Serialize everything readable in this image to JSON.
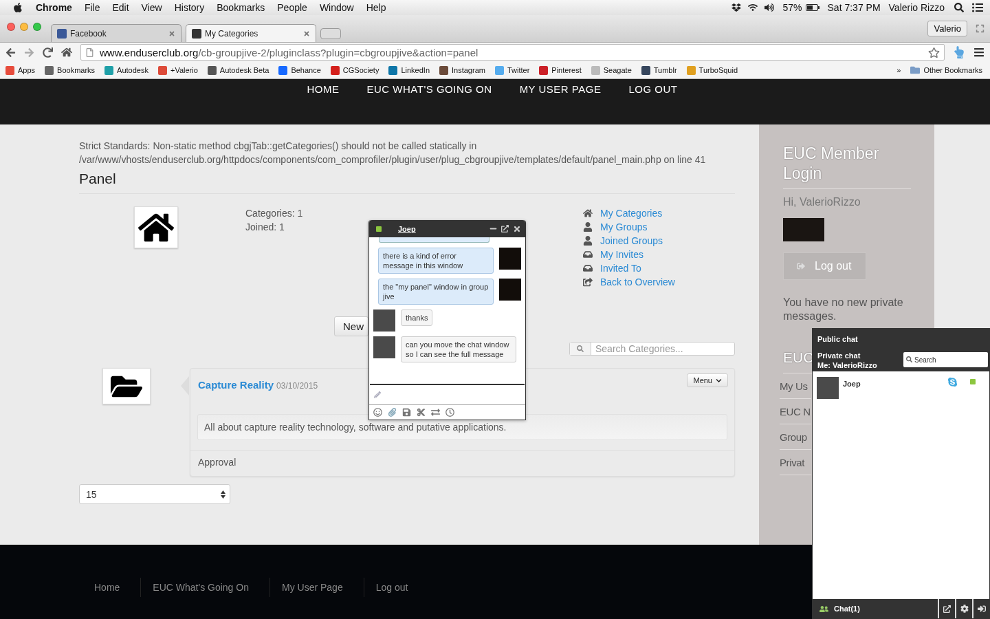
{
  "menubar": {
    "app": "Chrome",
    "menus": [
      "File",
      "Edit",
      "View",
      "History",
      "Bookmarks",
      "People",
      "Window",
      "Help"
    ],
    "battery": "57%",
    "clock": "Sat 7:37 PM",
    "user": "Valerio Rizzo"
  },
  "browser": {
    "tabs": [
      {
        "title": "Facebook",
        "selected": false,
        "color": "#3b5998"
      },
      {
        "title": "My Categories",
        "selected": true,
        "color": "#333333"
      }
    ],
    "profile": "Valerio",
    "url_host": "www.enduserclub.org",
    "url_path": "/cb-groupjive-2/pluginclass?plugin=cbgroupjive&action=panel",
    "bookmarks": [
      {
        "label": "Apps",
        "color": "#e74c3c"
      },
      {
        "label": "Bookmarks",
        "color": "#666666"
      },
      {
        "label": "Autodesk",
        "color": "#1fa0a8"
      },
      {
        "label": "+Valerio",
        "color": "#dd4b39"
      },
      {
        "label": "Autodesk Beta",
        "color": "#555555"
      },
      {
        "label": "Behance",
        "color": "#1769ff"
      },
      {
        "label": "CGSociety",
        "color": "#d4201c"
      },
      {
        "label": "LinkedIn",
        "color": "#0e76a8"
      },
      {
        "label": "Instagram",
        "color": "#6b4b3a"
      },
      {
        "label": "Twitter",
        "color": "#55acee"
      },
      {
        "label": "Pinterest",
        "color": "#cb2027"
      },
      {
        "label": "Seagate",
        "color": "#bbbbbb"
      },
      {
        "label": "Tumblr",
        "color": "#36465d"
      },
      {
        "label": "TurboSquid",
        "color": "#e0a020"
      }
    ],
    "overflow": "»",
    "other_bookmarks": "Other Bookmarks"
  },
  "site_nav": [
    "HOME",
    "EUC WHAT'S GOING ON",
    "MY USER PAGE",
    "LOG OUT"
  ],
  "content": {
    "notice": "Strict Standards: Non-static method cbgjTab::getCategories() should not be called statically in /var/www/vhosts/enduserclub.org/httpdocs/components/com_comprofiler/plugin/user/plug_cbgroupjive/templates/default/panel_main.php on line 41",
    "title": "Panel",
    "stats": [
      "Categories: 1",
      "Joined: 1"
    ],
    "links": [
      {
        "label": "My Categories",
        "kind": "home"
      },
      {
        "label": "My Groups",
        "kind": "user"
      },
      {
        "label": "Joined Groups",
        "kind": "user"
      },
      {
        "label": "My Invites",
        "kind": "inbox"
      },
      {
        "label": "Invited To",
        "kind": "inbox"
      },
      {
        "label": "Back to Overview",
        "kind": "share"
      }
    ],
    "new_button": "New",
    "search_placeholder": "Search Categories...",
    "categories": [
      {
        "name": "Capture Reality",
        "date": "03/10/2015",
        "menu": "Menu",
        "description": "All about capture reality technology, software and putative applications.",
        "status": "Approval"
      }
    ],
    "page_size": "15"
  },
  "sidebar": {
    "title": "EUC Member Login",
    "greeting": "Hi, ValerioRizzo",
    "logout": "Log out",
    "messages": "You have no new private messages.",
    "second_title": "EUC",
    "items": [
      "My Us",
      "EUC N",
      "Group",
      "Privat"
    ]
  },
  "chat_window": {
    "contact": "Joep",
    "color": "#8cc63f",
    "messages": [
      {
        "kind": "sent",
        "text": "there is a kind of error message in this window"
      },
      {
        "kind": "sent",
        "text": "the \"my panel\" window in group jive"
      },
      {
        "kind": "received",
        "text": "thanks"
      },
      {
        "kind": "received",
        "text": "can you move the chat window so I can see the full message"
      }
    ]
  },
  "chat_dock": {
    "public": "Public chat",
    "private": "Private chat",
    "me": "Me: ValerioRizzo",
    "search_placeholder": "Search",
    "contacts": [
      {
        "name": "Joep",
        "color": "#8cc63f"
      }
    ],
    "footer": "Chat(1)"
  },
  "footer": [
    "Home",
    "EUC What's Going On",
    "My User Page",
    "Log out"
  ]
}
